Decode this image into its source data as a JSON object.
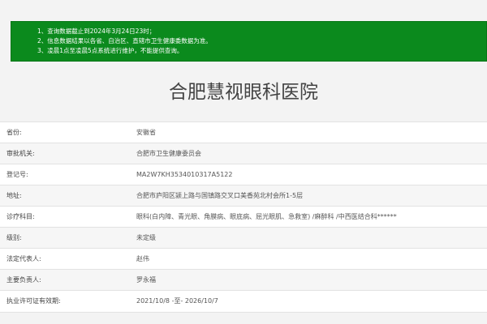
{
  "notice": {
    "items": [
      "1、查询数据截止到2024年3月24日23时；",
      "2、信息数据结果以各省、自治区、直辖市卫生健康委数据为准。",
      "3、凌晨1点至凌晨5点系统进行维护，不能提供查询。"
    ]
  },
  "hospital": {
    "name": "合肥慧视眼科医院"
  },
  "info": {
    "rows": [
      {
        "label": "省份:",
        "value": "安徽省"
      },
      {
        "label": "审批机关:",
        "value": "合肥市卫生健康委员会"
      },
      {
        "label": "登记号:",
        "value": "MA2W7KH3534010317A5122"
      },
      {
        "label": "地址:",
        "value": "合肥市庐阳区颍上路与国镇路交叉口美香苑北村会所1-5层"
      },
      {
        "label": "诊疗科目:",
        "value": "眼科(白内障、青光眼、角膜病、眼底病、屈光眼肌、急救室) /麻醉科 /中西医结合科******"
      },
      {
        "label": "级别:",
        "value": "未定级"
      },
      {
        "label": "法定代表人:",
        "value": "赵伟"
      },
      {
        "label": "主要负责人:",
        "value": "罗永福"
      },
      {
        "label": "执业许可证有效期:",
        "value": "2021/10/8 -至- 2026/10/7"
      }
    ]
  }
}
